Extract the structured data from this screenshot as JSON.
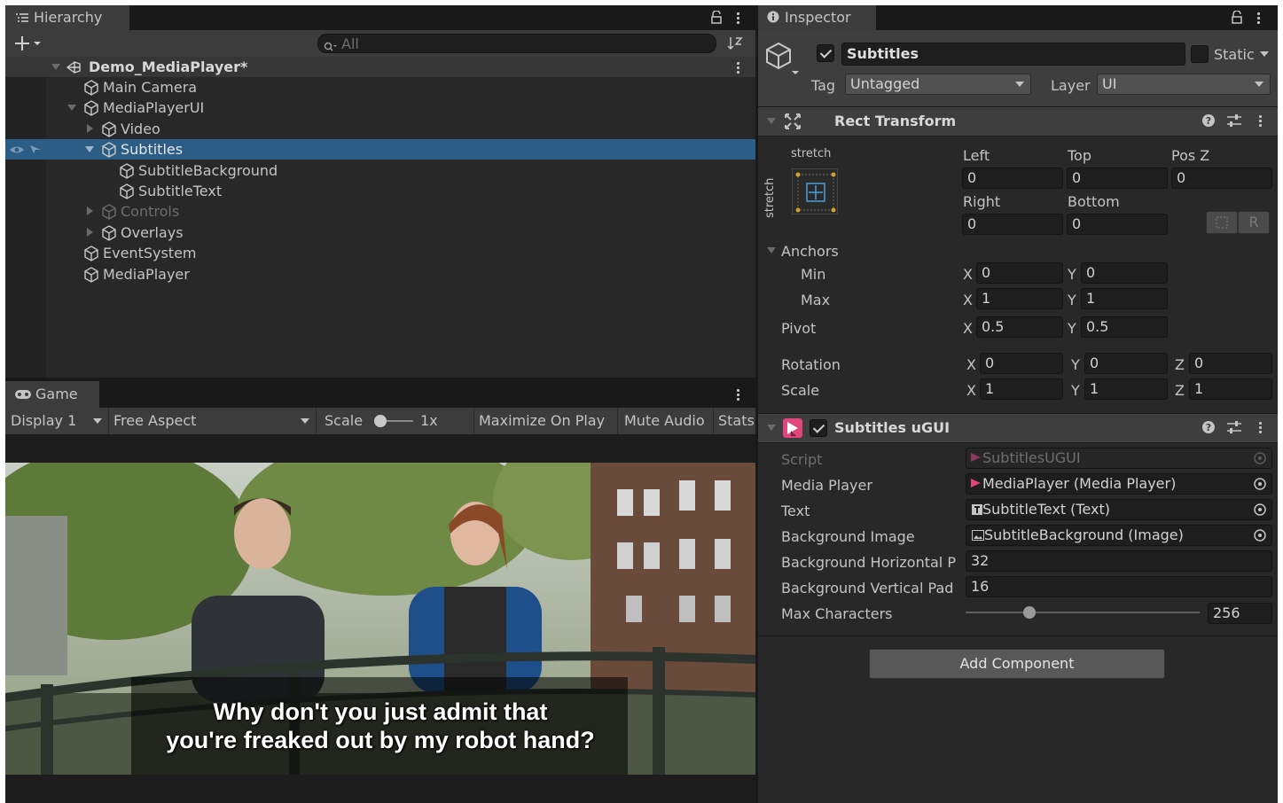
{
  "hierarchy": {
    "tab_label": "Hierarchy",
    "search_placeholder": "All",
    "scene_name": "Demo_MediaPlayer*",
    "items": [
      {
        "label": "Main Camera",
        "depth": 1,
        "expander": "none",
        "dimmed": false,
        "selected": false
      },
      {
        "label": "MediaPlayerUI",
        "depth": 1,
        "expander": "open",
        "dimmed": false,
        "selected": false
      },
      {
        "label": "Video",
        "depth": 2,
        "expander": "closed",
        "dimmed": false,
        "selected": false
      },
      {
        "label": "Subtitles",
        "depth": 2,
        "expander": "open",
        "dimmed": false,
        "selected": true
      },
      {
        "label": "SubtitleBackground",
        "depth": 3,
        "expander": "none",
        "dimmed": false,
        "selected": false
      },
      {
        "label": "SubtitleText",
        "depth": 3,
        "expander": "none",
        "dimmed": false,
        "selected": false
      },
      {
        "label": "Controls",
        "depth": 2,
        "expander": "closed",
        "dimmed": true,
        "selected": false
      },
      {
        "label": "Overlays",
        "depth": 2,
        "expander": "closed",
        "dimmed": false,
        "selected": false
      },
      {
        "label": "EventSystem",
        "depth": 1,
        "expander": "none",
        "dimmed": false,
        "selected": false
      },
      {
        "label": "MediaPlayer",
        "depth": 1,
        "expander": "none",
        "dimmed": false,
        "selected": false
      }
    ]
  },
  "game": {
    "tab_label": "Game",
    "display": "Display 1",
    "aspect": "Free Aspect",
    "scale_label": "Scale",
    "scale_value": "1x",
    "maximize": "Maximize On Play",
    "mute": "Mute Audio",
    "stats": "Stats",
    "subtitle_line1": "Why don't you just admit that",
    "subtitle_line2": "you're freaked out by my robot hand?"
  },
  "inspector": {
    "tab_label": "Inspector",
    "object_name": "Subtitles",
    "static_label": "Static",
    "tag_label": "Tag",
    "tag_value": "Untagged",
    "layer_label": "Layer",
    "layer_value": "UI",
    "rect_transform": {
      "title": "Rect Transform",
      "anchor_preset_h": "stretch",
      "anchor_preset_v": "stretch",
      "left_label": "Left",
      "left": "0",
      "top_label": "Top",
      "top": "0",
      "posz_label": "Pos Z",
      "posz": "0",
      "right_label": "Right",
      "right": "0",
      "bottom_label": "Bottom",
      "bottom": "0",
      "r_button": "R",
      "anchors_label": "Anchors",
      "min_label": "Min",
      "min_x": "0",
      "min_y": "0",
      "max_label": "Max",
      "max_x": "1",
      "max_y": "1",
      "pivot_label": "Pivot",
      "pivot_x": "0.5",
      "pivot_y": "0.5",
      "rotation_label": "Rotation",
      "rot_x": "0",
      "rot_y": "0",
      "rot_z": "0",
      "scale_label": "Scale",
      "scale_x": "1",
      "scale_y": "1",
      "scale_z": "1",
      "axis_x": "X",
      "axis_y": "Y",
      "axis_z": "Z"
    },
    "subtitles_ugui": {
      "title": "Subtitles uGUI",
      "script_label": "Script",
      "script_value": "SubtitlesUGUI",
      "media_player_label": "Media Player",
      "media_player_value": "MediaPlayer (Media Player)",
      "text_label": "Text",
      "text_value": "SubtitleText (Text)",
      "bg_image_label": "Background Image",
      "bg_image_value": "SubtitleBackground (Image)",
      "bg_hpad_label": "Background Horizontal P",
      "bg_hpad_value": "32",
      "bg_vpad_label": "Background Vertical Pad",
      "bg_vpad_value": "16",
      "max_chars_label": "Max Characters",
      "max_chars_value": "256",
      "max_chars_slider_fraction": 0.26
    },
    "add_component": "Add Component"
  },
  "colors": {
    "panel_bg": "#282828",
    "header_bg": "#3c3c3c",
    "selection": "#2c5d87",
    "accent_pink": "#e0457b",
    "text": "#c4c4c4"
  }
}
